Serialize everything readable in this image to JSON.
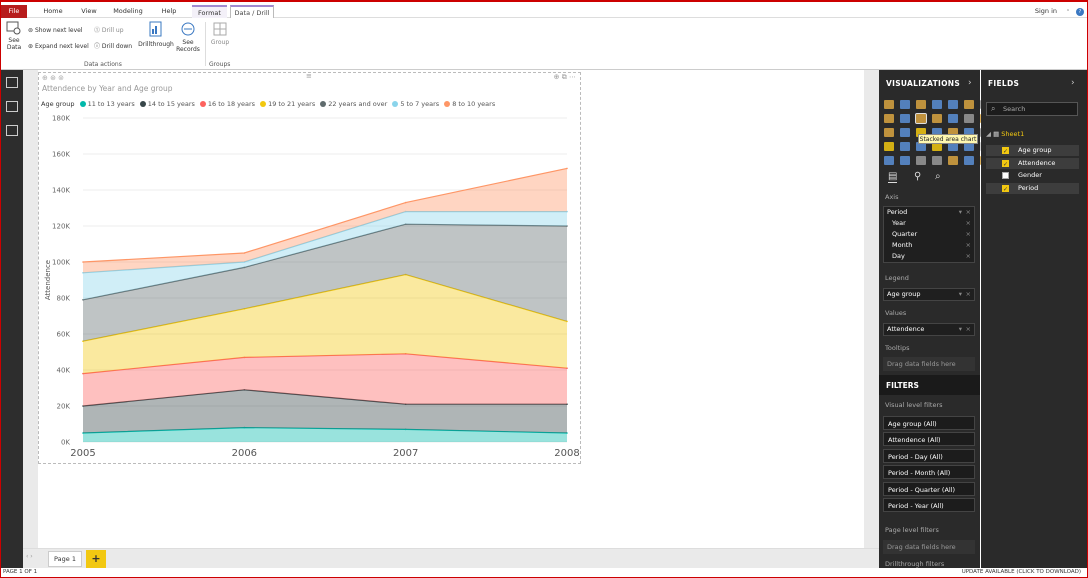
{
  "menu": {
    "file": "File",
    "items": [
      "Home",
      "View",
      "Modeling",
      "Help"
    ],
    "format": "Format",
    "data_drill": "Data / Drill",
    "sign_in": "Sign in"
  },
  "ribbon": {
    "see_data": "See Data",
    "show_next_level": "Show next level",
    "expand_next_level": "Expand next level",
    "drill_up": "Drill up",
    "drill_down": "Drill down",
    "drillthrough": "Drillthrough",
    "see_records": "See Records",
    "group": "Group",
    "group_data_actions": "Data actions",
    "group_groups": "Groups"
  },
  "visual": {
    "title": "Attendence by Year and Age group",
    "legend_title": "Age group"
  },
  "chart_data": {
    "type": "area",
    "stacked": true,
    "x": [
      "2005",
      "2006",
      "2007",
      "2008"
    ],
    "ylabel": "Attendence",
    "ylim": [
      0,
      180000
    ],
    "yticks": [
      "0K",
      "20K",
      "40K",
      "60K",
      "80K",
      "100K",
      "120K",
      "140K",
      "160K",
      "180K"
    ],
    "grid": true,
    "legend_position": "top-left",
    "series": [
      {
        "name": "11 to 13 years",
        "color": "#01b8aa",
        "values": [
          5000,
          8000,
          7000,
          5000
        ]
      },
      {
        "name": "14 to 15 years",
        "color": "#374649",
        "values": [
          15000,
          21000,
          14000,
          16000
        ]
      },
      {
        "name": "16 to 18 years",
        "color": "#fd625e",
        "values": [
          18000,
          18000,
          28000,
          20000
        ]
      },
      {
        "name": "19 to 21 years",
        "color": "#f2c80f",
        "values": [
          18000,
          27000,
          44000,
          26000
        ]
      },
      {
        "name": "22 years and over",
        "color": "#5f6b6d",
        "values": [
          23000,
          23000,
          28000,
          53000
        ]
      },
      {
        "name": "5 to 7 years",
        "color": "#8ad4eb",
        "values": [
          15000,
          3000,
          7000,
          8000
        ]
      },
      {
        "name": "8 to 10 years",
        "color": "#fe9666",
        "values": [
          6000,
          5000,
          5000,
          24000
        ]
      }
    ]
  },
  "tabs": {
    "page1": "Page 1",
    "add": "+"
  },
  "status": {
    "page": "PAGE 1 OF 1",
    "update": "UPDATE AVAILABLE (CLICK TO DOWNLOAD)"
  },
  "viz_pane": {
    "title": "VISUALIZATIONS",
    "tooltip": "Stacked area chart",
    "axis_label": "Axis",
    "axis_field": "Period",
    "axis_items": [
      "Year",
      "Quarter",
      "Month",
      "Day"
    ],
    "legend_label": "Legend",
    "legend_field": "Age group",
    "values_label": "Values",
    "values_field": "Attendence",
    "tooltips_label": "Tooltips",
    "drag_hint": "Drag data fields here",
    "filters_title": "FILTERS",
    "visual_level_filters": "Visual level filters",
    "filters": [
      "Age group  (All)",
      "Attendence  (All)",
      "Period - Day  (All)",
      "Period - Month  (All)",
      "Period - Quarter  (All)",
      "Period - Year  (All)"
    ],
    "page_level_filters": "Page level filters",
    "drillthrough_filters": "Drillthrough filters"
  },
  "fields_pane": {
    "title": "FIELDS",
    "search_placeholder": "Search",
    "table": "Sheet1",
    "fields": [
      {
        "name": "Age group",
        "checked": true
      },
      {
        "name": "Attendence",
        "checked": true
      },
      {
        "name": "Gender",
        "checked": false
      },
      {
        "name": "Period",
        "checked": true
      }
    ]
  }
}
